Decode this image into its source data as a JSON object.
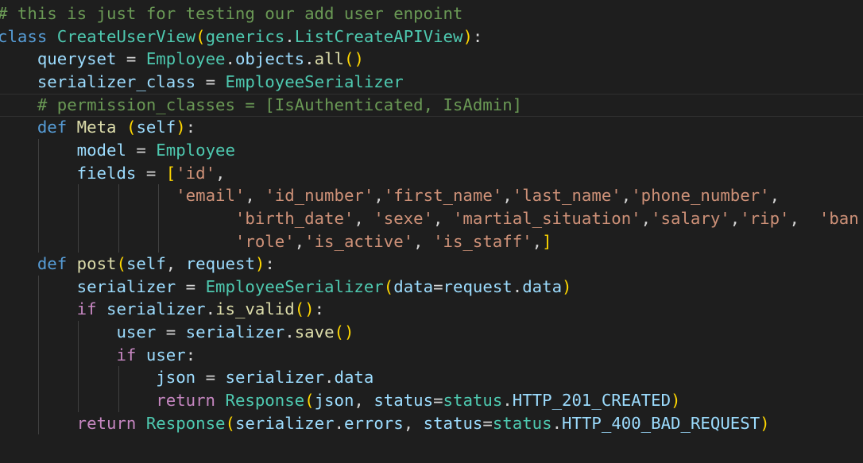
{
  "editor": {
    "lines": [
      {
        "tokens": [
          [
            "# this is just for testing our add user enpoint",
            "cm"
          ]
        ]
      },
      {
        "tokens": [
          [
            "class",
            "kw"
          ],
          [
            " ",
            "op"
          ],
          [
            "CreateUserView",
            "cls"
          ],
          [
            "(",
            "b1"
          ],
          [
            "generics",
            "cls"
          ],
          [
            ".",
            "op"
          ],
          [
            "ListCreateAPIView",
            "cls"
          ],
          [
            ")",
            "b1"
          ],
          [
            ":",
            "op"
          ]
        ]
      },
      {
        "tokens": [
          [
            "    ",
            "op"
          ],
          [
            "queryset",
            "var"
          ],
          [
            " = ",
            "op"
          ],
          [
            "Employee",
            "cls"
          ],
          [
            ".",
            "op"
          ],
          [
            "objects",
            "var"
          ],
          [
            ".",
            "op"
          ],
          [
            "all",
            "fn"
          ],
          [
            "()",
            "b1"
          ]
        ]
      },
      {
        "tokens": [
          [
            "    ",
            "op"
          ],
          [
            "serializer_class",
            "var"
          ],
          [
            " = ",
            "op"
          ],
          [
            "EmployeeSerializer",
            "cls"
          ]
        ]
      },
      {
        "tokens": [
          [
            "    ",
            "op"
          ],
          [
            "# permission_classes = [IsAuthenticated, IsAdmin]",
            "cm"
          ]
        ]
      },
      {
        "tokens": [
          [
            "    ",
            "op"
          ],
          [
            "def",
            "kw"
          ],
          [
            " ",
            "op"
          ],
          [
            "Meta",
            "fn"
          ],
          [
            " ",
            "op"
          ],
          [
            "(",
            "b1"
          ],
          [
            "self",
            "var"
          ],
          [
            ")",
            "b1"
          ],
          [
            ":",
            "op"
          ]
        ]
      },
      {
        "tokens": [
          [
            "        ",
            "op"
          ],
          [
            "model",
            "var"
          ],
          [
            " = ",
            "op"
          ],
          [
            "Employee",
            "cls"
          ]
        ]
      },
      {
        "tokens": [
          [
            "        ",
            "op"
          ],
          [
            "fields",
            "var"
          ],
          [
            " = ",
            "op"
          ],
          [
            "[",
            "b1"
          ],
          [
            "'id'",
            "str"
          ],
          [
            ",",
            "op"
          ]
        ]
      },
      {
        "tokens": [
          [
            "                  ",
            "op"
          ],
          [
            "'email'",
            "str"
          ],
          [
            ", ",
            "op"
          ],
          [
            "'id_number'",
            "str"
          ],
          [
            ",",
            "op"
          ],
          [
            "'first_name'",
            "str"
          ],
          [
            ",",
            "op"
          ],
          [
            "'last_name'",
            "str"
          ],
          [
            ",",
            "op"
          ],
          [
            "'phone_number'",
            "str"
          ],
          [
            ",",
            "op"
          ]
        ]
      },
      {
        "tokens": [
          [
            "                        ",
            "op"
          ],
          [
            "'birth_date'",
            "str"
          ],
          [
            ", ",
            "op"
          ],
          [
            "'sexe'",
            "str"
          ],
          [
            ", ",
            "op"
          ],
          [
            "'martial_situation'",
            "str"
          ],
          [
            ",",
            "op"
          ],
          [
            "'salary'",
            "str"
          ],
          [
            ",",
            "op"
          ],
          [
            "'rip'",
            "str"
          ],
          [
            ",  ",
            "op"
          ],
          [
            "'ban",
            "str"
          ]
        ]
      },
      {
        "tokens": [
          [
            "                        ",
            "op"
          ],
          [
            "'role'",
            "str"
          ],
          [
            ",",
            "op"
          ],
          [
            "'is_active'",
            "str"
          ],
          [
            ", ",
            "op"
          ],
          [
            "'is_staff'",
            "str"
          ],
          [
            ",",
            "op"
          ],
          [
            "]",
            "b1"
          ]
        ]
      },
      {
        "tokens": [
          [
            "    ",
            "op"
          ],
          [
            "def",
            "kw"
          ],
          [
            " ",
            "op"
          ],
          [
            "post",
            "fn"
          ],
          [
            "(",
            "b1"
          ],
          [
            "self",
            "var"
          ],
          [
            ", ",
            "op"
          ],
          [
            "request",
            "var"
          ],
          [
            ")",
            "b1"
          ],
          [
            ":",
            "op"
          ]
        ]
      },
      {
        "tokens": [
          [
            "        ",
            "op"
          ],
          [
            "serializer",
            "var"
          ],
          [
            " = ",
            "op"
          ],
          [
            "EmployeeSerializer",
            "cls"
          ],
          [
            "(",
            "b1"
          ],
          [
            "data",
            "var"
          ],
          [
            "=",
            "op"
          ],
          [
            "request",
            "var"
          ],
          [
            ".",
            "op"
          ],
          [
            "data",
            "var"
          ],
          [
            ")",
            "b1"
          ]
        ]
      },
      {
        "tokens": [
          [
            "        ",
            "op"
          ],
          [
            "if",
            "ctl"
          ],
          [
            " ",
            "op"
          ],
          [
            "serializer",
            "var"
          ],
          [
            ".",
            "op"
          ],
          [
            "is_valid",
            "fn"
          ],
          [
            "()",
            "b1"
          ],
          [
            ":",
            "op"
          ]
        ]
      },
      {
        "tokens": [
          [
            "            ",
            "op"
          ],
          [
            "user",
            "var"
          ],
          [
            " = ",
            "op"
          ],
          [
            "serializer",
            "var"
          ],
          [
            ".",
            "op"
          ],
          [
            "save",
            "fn"
          ],
          [
            "()",
            "b1"
          ]
        ]
      },
      {
        "tokens": [
          [
            "            ",
            "op"
          ],
          [
            "if",
            "ctl"
          ],
          [
            " ",
            "op"
          ],
          [
            "user",
            "var"
          ],
          [
            ":",
            "op"
          ]
        ]
      },
      {
        "tokens": [
          [
            "                ",
            "op"
          ],
          [
            "json",
            "var"
          ],
          [
            " = ",
            "op"
          ],
          [
            "serializer",
            "var"
          ],
          [
            ".",
            "op"
          ],
          [
            "data",
            "var"
          ]
        ]
      },
      {
        "tokens": [
          [
            "                ",
            "op"
          ],
          [
            "return",
            "ctl"
          ],
          [
            " ",
            "op"
          ],
          [
            "Response",
            "cls"
          ],
          [
            "(",
            "b1"
          ],
          [
            "json",
            "var"
          ],
          [
            ", ",
            "op"
          ],
          [
            "status",
            "var"
          ],
          [
            "=",
            "op"
          ],
          [
            "status",
            "cls"
          ],
          [
            ".",
            "op"
          ],
          [
            "HTTP_201_CREATED",
            "var"
          ],
          [
            ")",
            "b1"
          ]
        ]
      },
      {
        "tokens": [
          [
            "        ",
            "op"
          ],
          [
            "return",
            "ctl"
          ],
          [
            " ",
            "op"
          ],
          [
            "Response",
            "cls"
          ],
          [
            "(",
            "b1"
          ],
          [
            "serializer",
            "var"
          ],
          [
            ".",
            "op"
          ],
          [
            "errors",
            "var"
          ],
          [
            ", ",
            "op"
          ],
          [
            "status",
            "var"
          ],
          [
            "=",
            "op"
          ],
          [
            "status",
            "cls"
          ],
          [
            ".",
            "op"
          ],
          [
            "HTTP_400_BAD_REQUEST",
            "var"
          ],
          [
            ")",
            "b1"
          ]
        ]
      }
    ]
  },
  "colors": {
    "background": "#1e1e1e",
    "comment": "#6a9955",
    "keyword": "#569cd6",
    "control": "#c586c0",
    "class": "#4ec9b0",
    "function": "#dcdcaa",
    "variable": "#9cdcfe",
    "string": "#ce9178",
    "bracket": "#ffd700"
  }
}
